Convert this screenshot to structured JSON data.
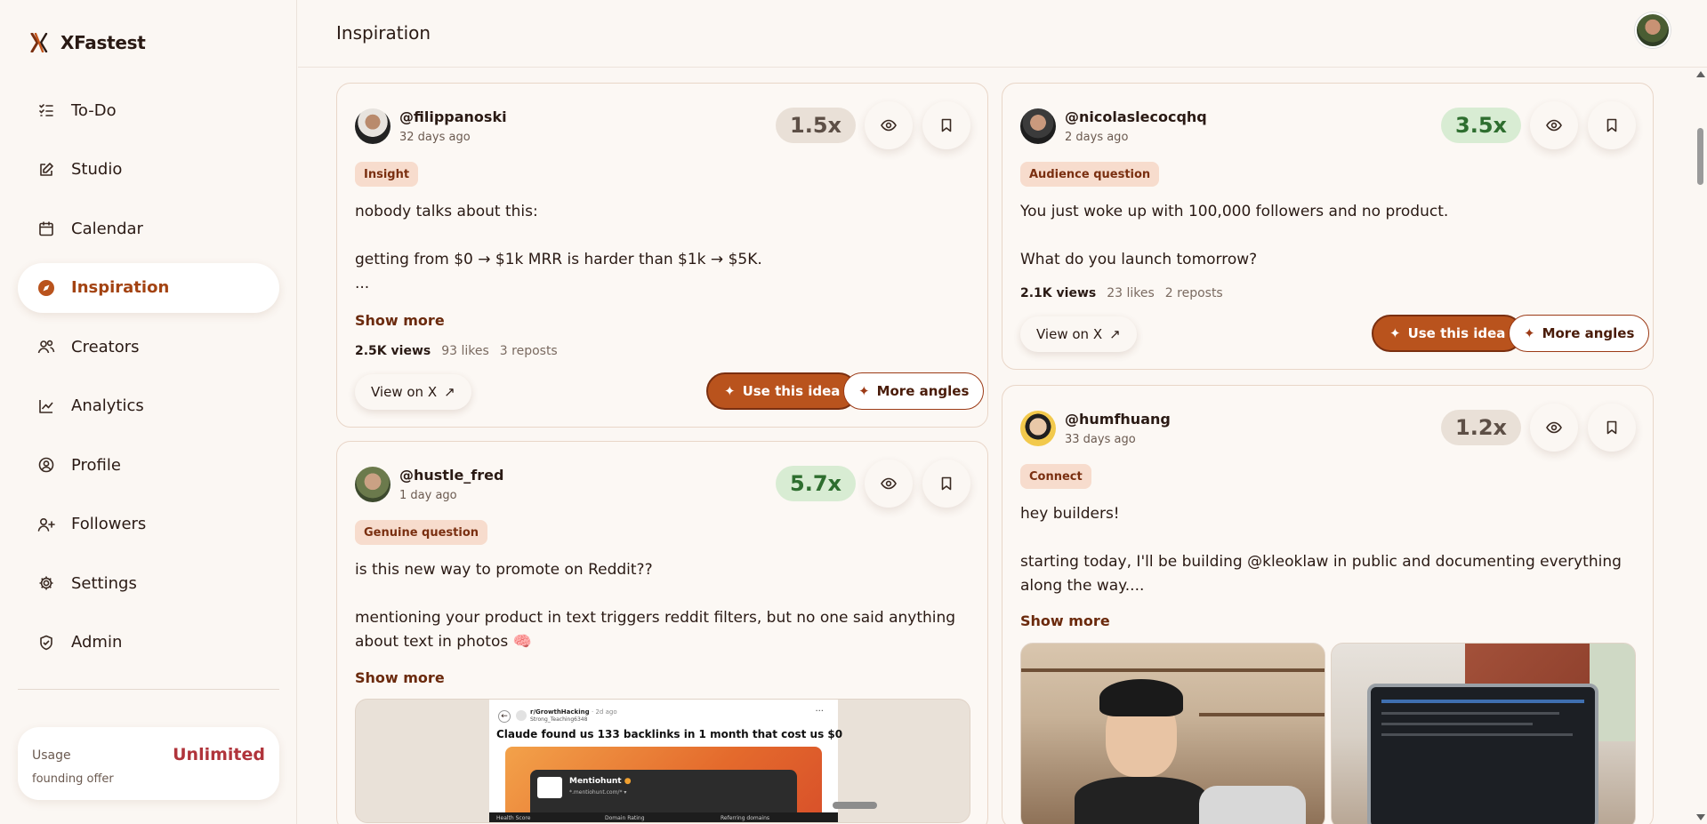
{
  "app": {
    "name": "XFastest"
  },
  "header": {
    "title": "Inspiration"
  },
  "nav": [
    {
      "label": "To-Do",
      "icon": "list-check-icon"
    },
    {
      "label": "Studio",
      "icon": "edit-icon"
    },
    {
      "label": "Calendar",
      "icon": "calendar-icon"
    },
    {
      "label": "Inspiration",
      "icon": "compass-icon",
      "active": true
    },
    {
      "label": "Creators",
      "icon": "users-icon"
    },
    {
      "label": "Analytics",
      "icon": "chart-line-icon"
    },
    {
      "label": "Profile",
      "icon": "user-circle-icon"
    },
    {
      "label": "Followers",
      "icon": "user-plus-icon"
    },
    {
      "label": "Settings",
      "icon": "gear-icon"
    },
    {
      "label": "Admin",
      "icon": "shield-check-icon"
    }
  ],
  "usage": {
    "label": "Usage",
    "value": "Unlimited",
    "sub": "founding offer"
  },
  "cards": [
    {
      "handle": "@filippanoski",
      "time": "32 days ago",
      "multiplier": "1.5x",
      "tag": "Insight",
      "text": "nobody talks about this:\n\ngetting from $0 → $1k MRR is harder than $1k → $5K.\n...",
      "show_more": "Show more",
      "views": "2.5K views",
      "likes": "93 likes",
      "reposts": "3 reposts",
      "view_on_x": "View on X",
      "use_idea": "Use this idea",
      "more_angles": "More angles"
    },
    {
      "handle": "@nicolaslecocqhq",
      "time": "2 days ago",
      "multiplier": "3.5x",
      "tag": "Audience question",
      "text": "You just woke up with 100,000 followers and no product.\n\nWhat do you launch tomorrow?",
      "views": "2.1K views",
      "likes": "23 likes",
      "reposts": "2 reposts",
      "view_on_x": "View on X",
      "use_idea": "Use this idea",
      "more_angles": "More angles"
    },
    {
      "handle": "@hustle_fred",
      "time": "1 day ago",
      "multiplier": "5.7x",
      "tag": "Genuine question",
      "text": "is this new way to promote on Reddit??\n\nmentioning your product in text triggers reddit filters, but no one said anything about text in photos 🧠",
      "show_more": "Show more",
      "media": {
        "sub": "r/GrowthHacking",
        "meta": "· 2d ago",
        "user": "Strong_Teaching6348",
        "headline": "Claude found us 133 backlinks in 1 month that cost us $0",
        "site_name": "Mentiohunt",
        "site_url": "*.mentiohunt.com/* ▾",
        "metrics": [
          "Health Score",
          "Domain Rating",
          "Referring domains"
        ]
      }
    },
    {
      "handle": "@humfhuang",
      "time": "33 days ago",
      "multiplier": "1.2x",
      "tag": "Connect",
      "text": "hey builders!\n\nstarting today, I'll be building @kleoklaw in public and documenting everything along the way....",
      "show_more": "Show more"
    }
  ],
  "colors": {
    "accent": "#a34312",
    "green_mult": "#d8ecd3",
    "grey_mult": "#e9e0d7",
    "tag_bg": "#f7dccd",
    "usage_value": "#b0343b"
  }
}
